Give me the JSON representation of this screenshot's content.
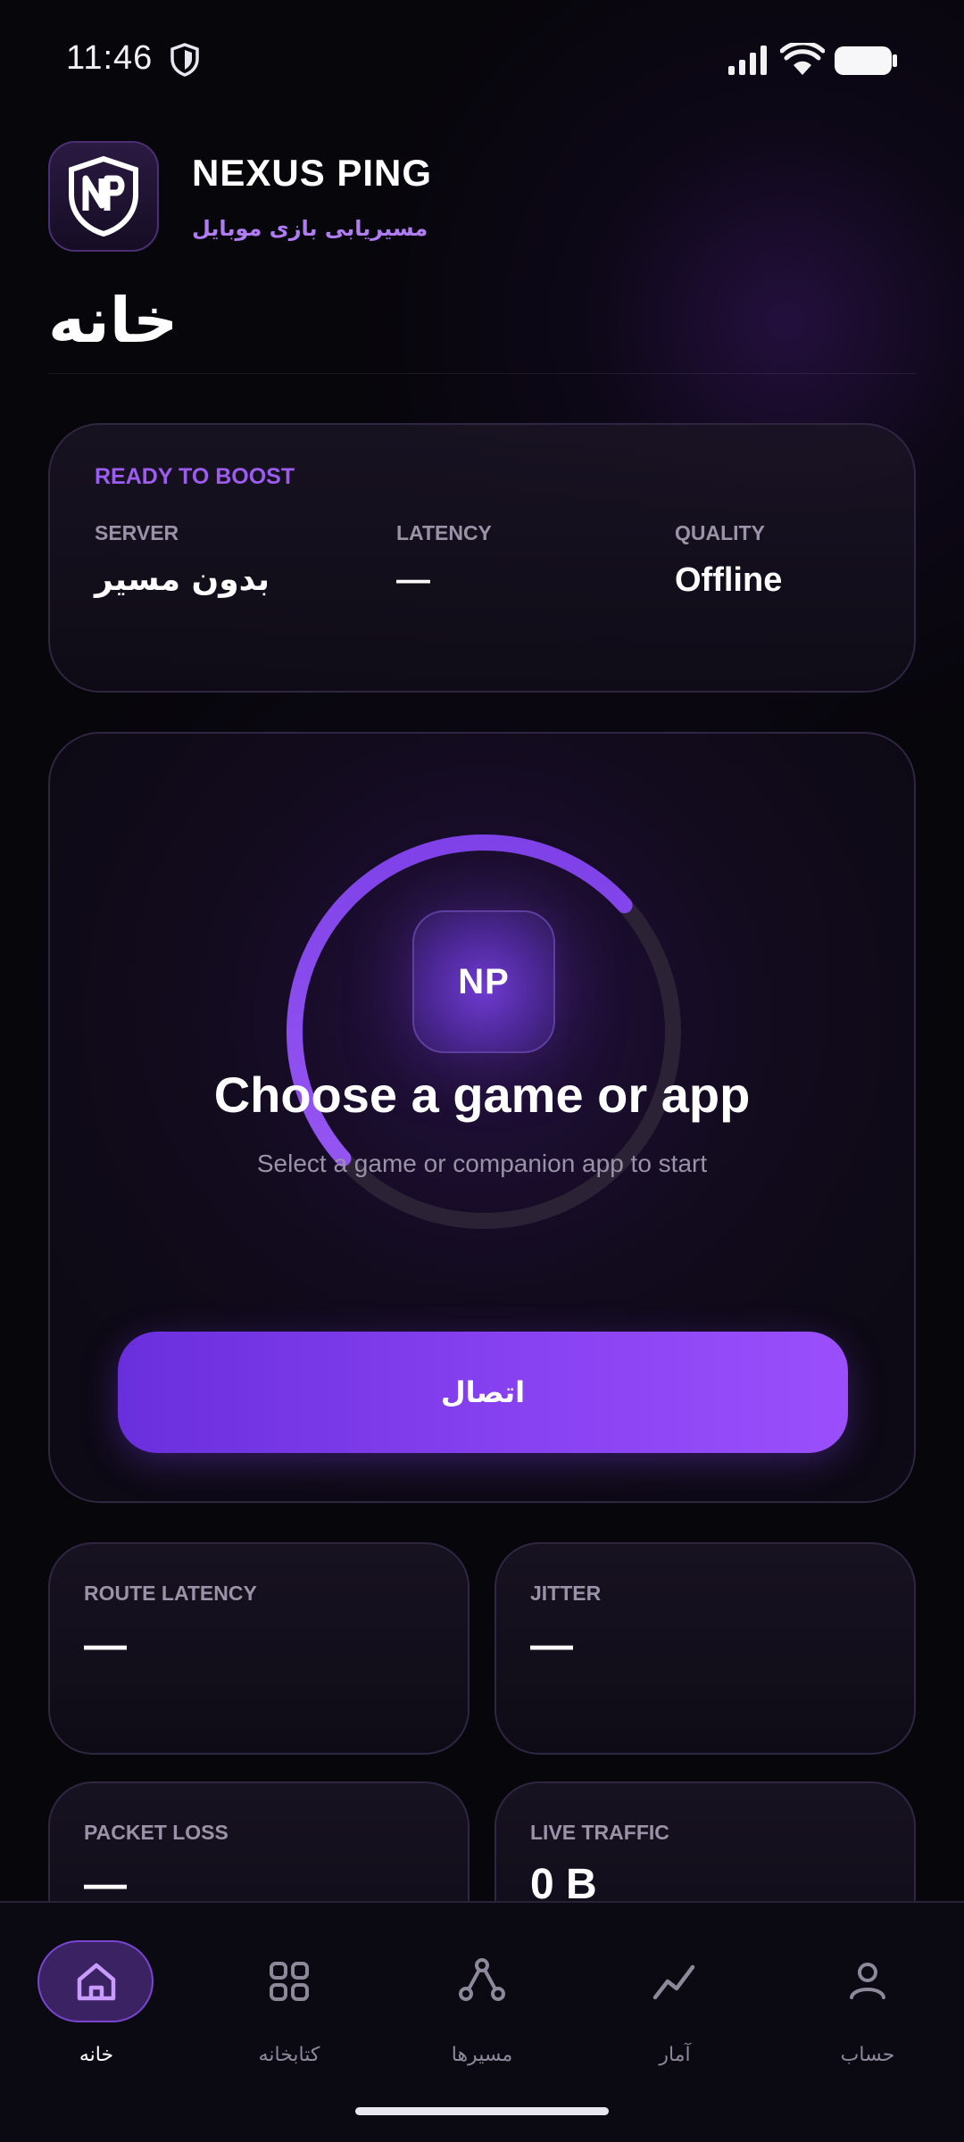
{
  "status_bar": {
    "time": "11:46"
  },
  "header": {
    "brand_name": "NEXUS PING",
    "brand_subtitle": "مسیریابی بازی موبایل",
    "page_title": "خانه"
  },
  "status_card": {
    "ready_label": "READY TO BOOST",
    "server_label": "SERVER",
    "server_value": "بدون مسیر",
    "latency_label": "LATENCY",
    "latency_value": "—",
    "quality_label": "QUALITY",
    "quality_value": "Offline"
  },
  "connect_card": {
    "logo_text": "NP",
    "title": "Choose a game or app",
    "subtitle": "Select a game or companion app to start",
    "connect_button": "اتصال",
    "ring_progress": 0.5
  },
  "metrics": [
    {
      "label": "ROUTE LATENCY",
      "value": "—"
    },
    {
      "label": "JITTER",
      "value": "—"
    },
    {
      "label": "PACKET LOSS",
      "value": "—"
    },
    {
      "label": "LIVE TRAFFIC",
      "value": "0 B"
    }
  ],
  "bottom_nav": [
    {
      "label": "خانه",
      "icon": "home-icon",
      "active": true
    },
    {
      "label": "کتابخانه",
      "icon": "grid-icon",
      "active": false
    },
    {
      "label": "مسیرها",
      "icon": "routes-icon",
      "active": false
    },
    {
      "label": "آمار",
      "icon": "stats-icon",
      "active": false
    },
    {
      "label": "حساب",
      "icon": "user-icon",
      "active": false
    }
  ],
  "colors": {
    "accent": "#8a43f2",
    "background": "#07060b",
    "label": "#9a93a8"
  }
}
